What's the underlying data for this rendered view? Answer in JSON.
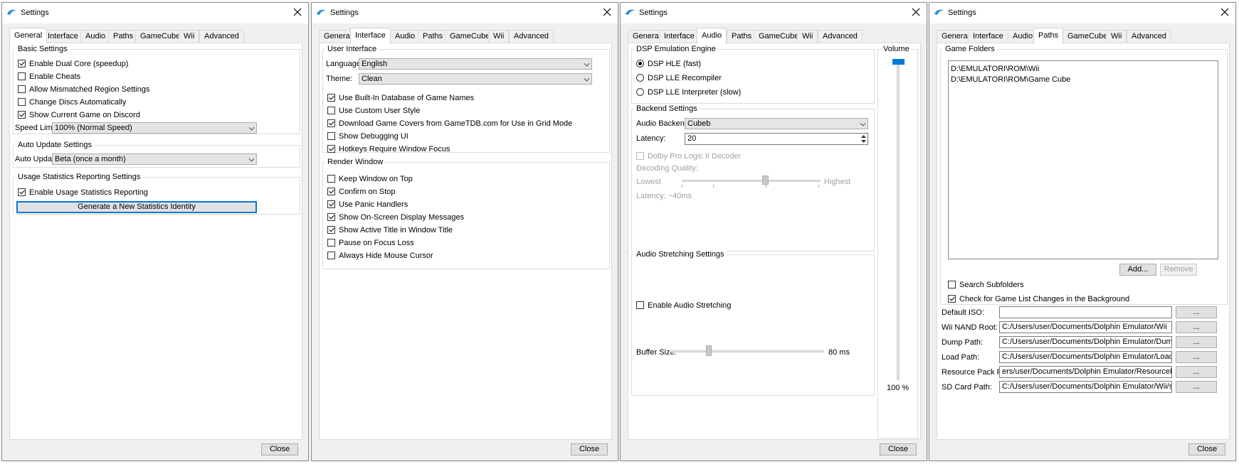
{
  "window_title": "Settings",
  "tabs": [
    "General",
    "Interface",
    "Audio",
    "Paths",
    "GameCube",
    "Wii",
    "Advanced"
  ],
  "close_label": "Close",
  "general": {
    "basic_title": "Basic Settings",
    "basic": [
      {
        "label": "Enable Dual Core (speedup)",
        "checked": true
      },
      {
        "label": "Enable Cheats",
        "checked": false
      },
      {
        "label": "Allow Mismatched Region Settings",
        "checked": false
      },
      {
        "label": "Change Discs Automatically",
        "checked": false
      },
      {
        "label": "Show Current Game on Discord",
        "checked": true
      }
    ],
    "speed_limit_label": "Speed Limit:",
    "speed_limit_value": "100% (Normal Speed)",
    "auto_update_title": "Auto Update Settings",
    "auto_update_label": "Auto Update:",
    "auto_update_value": "Beta (once a month)",
    "usage_title": "Usage Statistics Reporting Settings",
    "usage_checkbox": {
      "label": "Enable Usage Statistics Reporting",
      "checked": true
    },
    "generate_button": "Generate a New Statistics Identity"
  },
  "interface": {
    "ui_title": "User Interface",
    "language_label": "Language:",
    "language_value": "English",
    "theme_label": "Theme:",
    "theme_value": "Clean",
    "ui_options": [
      {
        "label": "Use Built-In Database of Game Names",
        "checked": true
      },
      {
        "label": "Use Custom User Style",
        "checked": false
      },
      {
        "label": "Download Game Covers from GameTDB.com for Use in Grid Mode",
        "checked": true
      },
      {
        "label": "Show Debugging UI",
        "checked": false
      },
      {
        "label": "Hotkeys Require Window Focus",
        "checked": true
      }
    ],
    "render_title": "Render Window",
    "render_options": [
      {
        "label": "Keep Window on Top",
        "checked": false
      },
      {
        "label": "Confirm on Stop",
        "checked": true
      },
      {
        "label": "Use Panic Handlers",
        "checked": true
      },
      {
        "label": "Show On-Screen Display Messages",
        "checked": true
      },
      {
        "label": "Show Active Title in Window Title",
        "checked": true
      },
      {
        "label": "Pause on Focus Loss",
        "checked": false
      },
      {
        "label": "Always Hide Mouse Cursor",
        "checked": false
      }
    ]
  },
  "audio": {
    "dsp_title": "DSP Emulation Engine",
    "dsp_options": [
      {
        "label": "DSP HLE (fast)",
        "selected": true
      },
      {
        "label": "DSP LLE Recompiler",
        "selected": false
      },
      {
        "label": "DSP LLE Interpreter (slow)",
        "selected": false
      }
    ],
    "volume_title": "Volume",
    "volume_value": "100 %",
    "volume_level": 1.0,
    "backend_title": "Backend Settings",
    "backend_label": "Audio Backend:",
    "backend_value": "Cubeb",
    "latency_label": "Latency:",
    "latency_value": "20",
    "dolby_label": "Dolby Pro Logic II Decoder",
    "decoding_quality_label": "Decoding Quality:",
    "lowest_label": "Lowest",
    "highest_label": "Highest",
    "decoding_latency": "Latency: ~40ms",
    "stretch_title": "Audio Stretching Settings",
    "stretch_checkbox": {
      "label": "Enable Audio Stretching",
      "checked": false
    },
    "buffer_label": "Buffer Size:",
    "buffer_value": "80 ms"
  },
  "paths": {
    "folders_title": "Game Folders",
    "folders": [
      "D:\\EMULATORI\\ROM\\Wii",
      "D:\\EMULATORI\\ROM\\Game Cube"
    ],
    "add_button": "Add...",
    "remove_button": "Remove",
    "search_subfolders": {
      "label": "Search Subfolders",
      "checked": false
    },
    "check_changes": {
      "label": "Check for Game List Changes in the Background",
      "checked": true
    },
    "browse_label": "...",
    "path_rows": [
      {
        "label": "Default ISO:",
        "value": ""
      },
      {
        "label": "Wii NAND Root:",
        "value": "C:/Users/user/Documents/Dolphin Emulator/Wii"
      },
      {
        "label": "Dump Path:",
        "value": "C:/Users/user/Documents/Dolphin Emulator/Dump/"
      },
      {
        "label": "Load Path:",
        "value": "C:/Users/user/Documents/Dolphin Emulator/Load/"
      },
      {
        "label": "Resource Pack Path:",
        "value": "ers/user/Documents/Dolphin Emulator/ResourcePacks/"
      },
      {
        "label": "SD Card Path:",
        "value": "C:/Users/user/Documents/Dolphin Emulator/Wii/sd.raw"
      }
    ]
  }
}
